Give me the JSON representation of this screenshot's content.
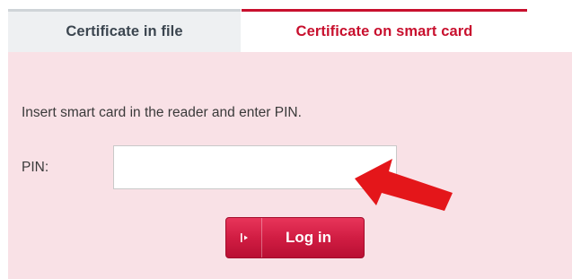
{
  "tabs": {
    "file_label": "Certificate in file",
    "card_label": "Certificate on smart card"
  },
  "panel": {
    "instruction": "Insert smart card in the reader and enter PIN.",
    "pin_label": "PIN:",
    "pin_value": "",
    "login_label": "Log in",
    "login_icon": "login-icon"
  },
  "annotation": {
    "arrow_icon": "red-arrow",
    "arrow_color": "#e4161a"
  },
  "colors": {
    "accent": "#c8102e",
    "panel_background": "#f9e1e6",
    "inactive_tab_background": "#eef0f2"
  }
}
